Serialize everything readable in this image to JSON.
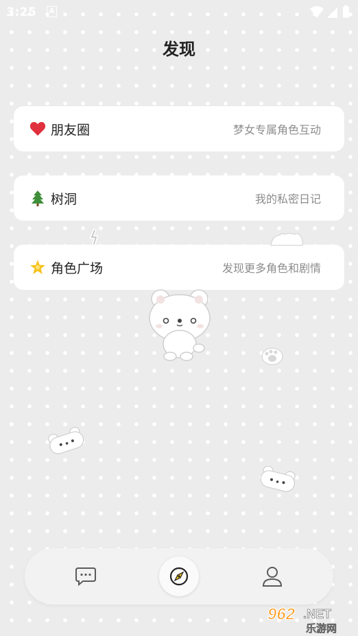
{
  "status_bar": {
    "time": "3:25",
    "notification_glyph": "A",
    "icons": [
      "wifi-icon",
      "signal-icon",
      "battery-icon"
    ]
  },
  "page": {
    "title": "发现"
  },
  "menu": [
    {
      "icon": "heart-icon",
      "label": "朋友圈",
      "subtitle": "梦女专属角色互动"
    },
    {
      "icon": "tree-icon",
      "label": "树洞",
      "subtitle": "我的私密日记"
    },
    {
      "icon": "star-icon",
      "label": "角色广场",
      "subtitle": "发现更多角色和剧情"
    }
  ],
  "bottom_nav": {
    "items": [
      {
        "icon": "chat-icon",
        "active": false
      },
      {
        "icon": "compass-icon",
        "active": true
      },
      {
        "icon": "profile-icon",
        "active": false
      }
    ]
  },
  "watermark": {
    "brand": "962",
    "suffix": ".NET",
    "caption": "乐游网"
  },
  "colors": {
    "background": "#ececec",
    "card": "#ffffff",
    "title": "#222222",
    "subtitle": "#8c8c8c",
    "accent_compass": "#f2c21a"
  }
}
